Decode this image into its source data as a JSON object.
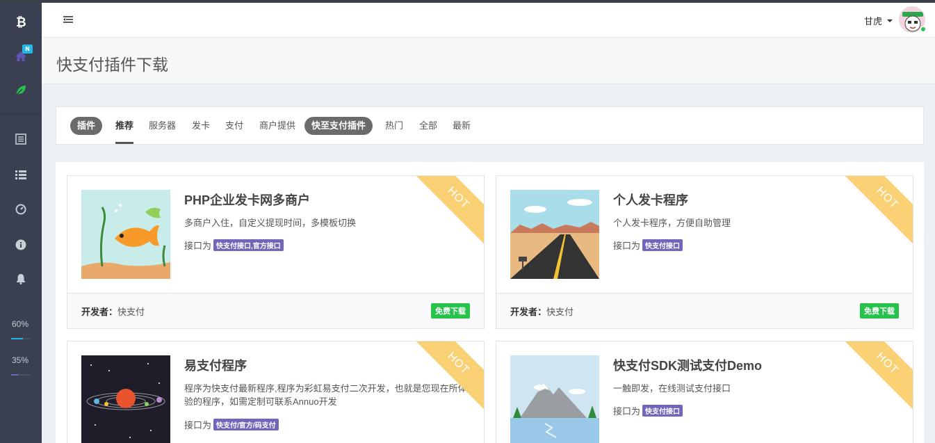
{
  "sidebar": {
    "items": [
      {
        "icon": "bitcoin-icon"
      },
      {
        "icon": "home-icon",
        "badge": "N"
      },
      {
        "icon": "leaf-icon"
      },
      {
        "icon": "list-alt-icon"
      },
      {
        "icon": "list-icon"
      },
      {
        "icon": "dashboard-icon"
      },
      {
        "icon": "info-icon"
      },
      {
        "icon": "bell-icon"
      }
    ],
    "stats": [
      {
        "label": "60%",
        "value": 0.6,
        "color": "#23b7e5"
      },
      {
        "label": "35%",
        "value": 0.35,
        "color": "#7266ba"
      }
    ]
  },
  "header": {
    "user_name": "甘虎",
    "menu_icon": "menu-toggle-icon"
  },
  "page": {
    "title": "快支付插件下载"
  },
  "tabs": [
    {
      "label": "插件",
      "style": "pill"
    },
    {
      "label": "推荐",
      "style": "active"
    },
    {
      "label": "服务器",
      "style": "plain"
    },
    {
      "label": "发卡",
      "style": "plain"
    },
    {
      "label": "支付",
      "style": "plain"
    },
    {
      "label": "商户提供",
      "style": "plain"
    },
    {
      "label": "快至支付插件",
      "style": "pill"
    },
    {
      "label": "热门",
      "style": "plain"
    },
    {
      "label": "全部",
      "style": "plain"
    },
    {
      "label": "最新",
      "style": "plain"
    }
  ],
  "cards": [
    {
      "title": "PHP企业发卡网多商户",
      "desc": "多商户入住，自定义提现时间，多模板切换",
      "iface_label": "接口为",
      "iface_tag": "快支付接口,官方接口",
      "dev_label": "开发者：",
      "dev_name": "快支付",
      "button": "免费下载",
      "ribbon": "HOT"
    },
    {
      "title": "个人发卡程序",
      "desc": "个人发卡程序，方便自助管理",
      "iface_label": "接口为",
      "iface_tag": "快支付接口",
      "dev_label": "开发者：",
      "dev_name": "快支付",
      "button": "免费下载",
      "ribbon": "HOT"
    },
    {
      "title": "易支付程序",
      "desc": "程序为快支付最新程序,程序为彩虹易支付二次开发，也就是您现在所体验的程序，如需定制可联系Annuo开发",
      "iface_label": "接口为",
      "iface_tag": "快支付/官方/码支付",
      "ribbon": "HOT"
    },
    {
      "title": "快支付SDK测试支付Demo",
      "desc": "一触即发，在线测试支付接口",
      "iface_label": "接口为",
      "iface_tag": "快支付接口",
      "ribbon": "HOT"
    }
  ]
}
